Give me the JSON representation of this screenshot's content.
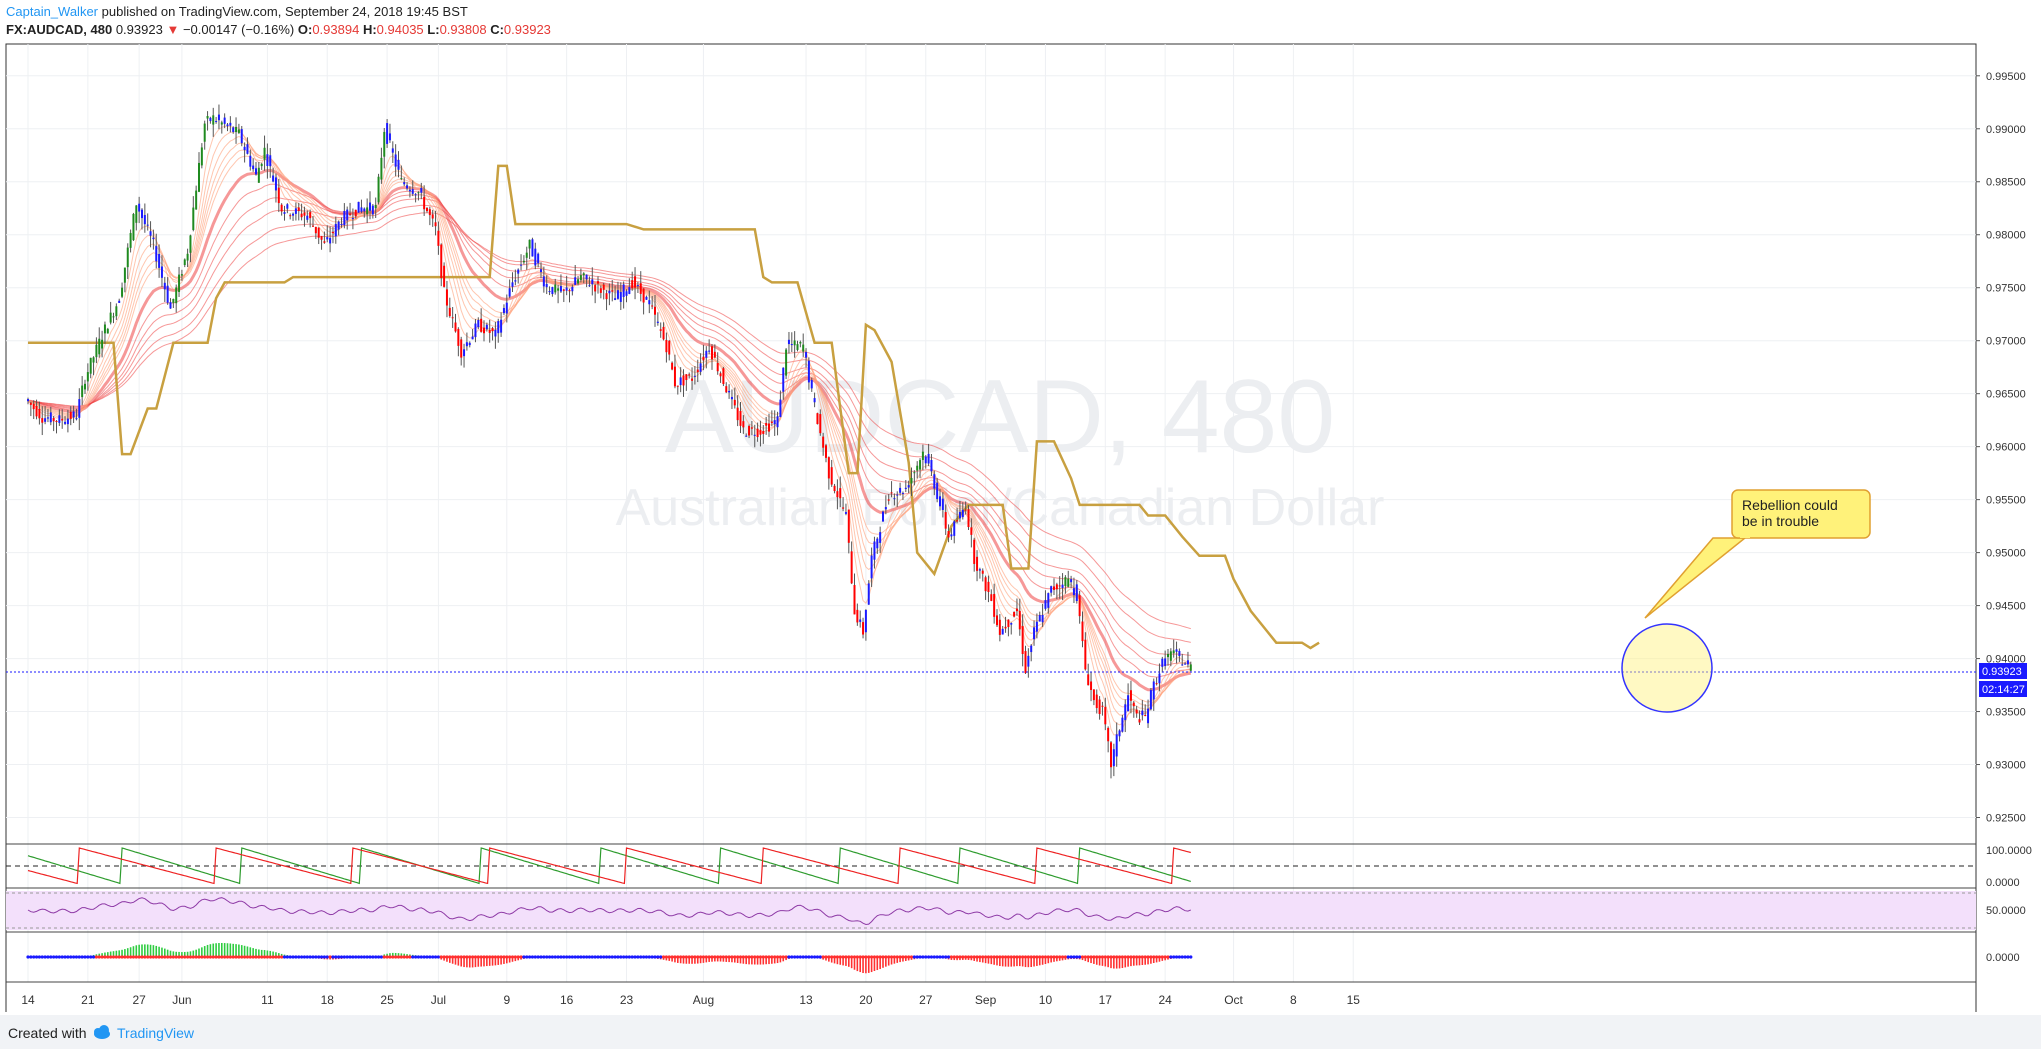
{
  "header": {
    "author": "Captain_Walker",
    "published_text": "published on TradingView.com, September 24, 2018 19:45 BST",
    "symbol": "FX:AUDCAD, 480",
    "last": "0.93923",
    "change": "−0.00147 (−0.16%)",
    "open_label": "O:",
    "open": "0.93894",
    "high_label": "H:",
    "high": "0.94035",
    "low_label": "L:",
    "low": "0.93808",
    "close_label": "C:",
    "close": "0.93923"
  },
  "watermark": {
    "symbol": "AUDCAD, 480",
    "name": "Australian Dollar/Canadian Dollar"
  },
  "annotation": {
    "line1": "Rebellion could",
    "line2": "be in trouble"
  },
  "price_tag": {
    "value": "0.93923",
    "countdown": "02:14:27"
  },
  "footer": {
    "created_with": "Created with",
    "brand": "TradingView"
  },
  "colors": {
    "bull": "#1f8a1f",
    "bear": "#ff0000",
    "neutral": "#1a1aff",
    "ema_short": "#ffa07a",
    "ema_long": "#ee4444",
    "trail": "#c8a040",
    "rsi_band": "#f3e0fb",
    "rsi_line": "#8e3aa6"
  },
  "chart_data": {
    "type": "candlestick",
    "y_axis": {
      "min": 0.9225,
      "max": 0.998,
      "tick_labels": [
        "0.99500",
        "0.99000",
        "0.98500",
        "0.98000",
        "0.97500",
        "0.97000",
        "0.96500",
        "0.96000",
        "0.95500",
        "0.95000",
        "0.94500",
        "0.94000",
        "0.93500",
        "0.93000",
        "0.92500"
      ],
      "tick_values": [
        0.995,
        0.99,
        0.985,
        0.98,
        0.975,
        0.97,
        0.965,
        0.96,
        0.955,
        0.95,
        0.945,
        0.94,
        0.935,
        0.93,
        0.925
      ]
    },
    "x_axis": {
      "labels": [
        "14",
        "21",
        "27",
        "Jun",
        "11",
        "18",
        "25",
        "Jul",
        "9",
        "16",
        "23",
        "Aug",
        "13",
        "20",
        "27",
        "Sep",
        "10",
        "17",
        "24",
        "Oct",
        "8",
        "15"
      ],
      "label_days": [
        0,
        7,
        13,
        18,
        28,
        35,
        42,
        48,
        56,
        63,
        70,
        79,
        91,
        98,
        105,
        112,
        119,
        126,
        133,
        141,
        148,
        155
      ],
      "first_day": "2018-05-14",
      "last_data_day": 133
    },
    "price_path": [
      [
        0,
        0.9645
      ],
      [
        2,
        0.9628
      ],
      [
        4,
        0.9625
      ],
      [
        6,
        0.963
      ],
      [
        7,
        0.9665
      ],
      [
        9,
        0.9705
      ],
      [
        11,
        0.974
      ],
      [
        13,
        0.983
      ],
      [
        15,
        0.979
      ],
      [
        17,
        0.973
      ],
      [
        19,
        0.9785
      ],
      [
        21,
        0.9905
      ],
      [
        22,
        0.991
      ],
      [
        25,
        0.9895
      ],
      [
        27,
        0.9855
      ],
      [
        28,
        0.988
      ],
      [
        30,
        0.9825
      ],
      [
        33,
        0.9818
      ],
      [
        35,
        0.979
      ],
      [
        37,
        0.9815
      ],
      [
        39,
        0.9825
      ],
      [
        41,
        0.9825
      ],
      [
        42,
        0.99
      ],
      [
        44,
        0.985
      ],
      [
        46,
        0.984
      ],
      [
        48,
        0.9805
      ],
      [
        49,
        0.9745
      ],
      [
        51,
        0.969
      ],
      [
        53,
        0.9715
      ],
      [
        55,
        0.9705
      ],
      [
        57,
        0.9755
      ],
      [
        59,
        0.979
      ],
      [
        61,
        0.975
      ],
      [
        63,
        0.9745
      ],
      [
        65,
        0.976
      ],
      [
        67,
        0.975
      ],
      [
        69,
        0.974
      ],
      [
        71,
        0.9755
      ],
      [
        73,
        0.9735
      ],
      [
        75,
        0.9695
      ],
      [
        76,
        0.966
      ],
      [
        78,
        0.9665
      ],
      [
        80,
        0.9695
      ],
      [
        82,
        0.9655
      ],
      [
        84,
        0.9615
      ],
      [
        86,
        0.9615
      ],
      [
        88,
        0.9625
      ],
      [
        89,
        0.9695
      ],
      [
        91,
        0.9695
      ],
      [
        92,
        0.965
      ],
      [
        94,
        0.9575
      ],
      [
        96,
        0.9535
      ],
      [
        97,
        0.9445
      ],
      [
        98,
        0.9425
      ],
      [
        99,
        0.9495
      ],
      [
        101,
        0.9555
      ],
      [
        103,
        0.956
      ],
      [
        105,
        0.9595
      ],
      [
        106,
        0.9575
      ],
      [
        108,
        0.9515
      ],
      [
        110,
        0.9545
      ],
      [
        111,
        0.9495
      ],
      [
        113,
        0.9455
      ],
      [
        114,
        0.9425
      ],
      [
        116,
        0.9445
      ],
      [
        117,
        0.939
      ],
      [
        118,
        0.9425
      ],
      [
        120,
        0.9465
      ],
      [
        122,
        0.9475
      ],
      [
        123,
        0.946
      ],
      [
        124,
        0.939
      ],
      [
        125,
        0.936
      ],
      [
        126,
        0.935
      ],
      [
        127,
        0.93
      ],
      [
        128,
        0.9335
      ],
      [
        129,
        0.9365
      ],
      [
        130,
        0.9345
      ],
      [
        131,
        0.9345
      ],
      [
        132,
        0.9375
      ],
      [
        133,
        0.9395
      ],
      [
        134,
        0.9405
      ],
      [
        135,
        0.94
      ],
      [
        136,
        0.9392
      ]
    ],
    "trail_path": [
      [
        0,
        0.9698
      ],
      [
        10,
        0.9698
      ],
      [
        11,
        0.9593
      ],
      [
        12,
        0.9593
      ],
      [
        14,
        0.9636
      ],
      [
        15,
        0.9636
      ],
      [
        17,
        0.9698
      ],
      [
        18,
        0.9698
      ],
      [
        21,
        0.9698
      ],
      [
        22,
        0.974
      ],
      [
        23,
        0.9755
      ],
      [
        30,
        0.9755
      ],
      [
        31,
        0.976
      ],
      [
        54,
        0.976
      ],
      [
        55,
        0.9865
      ],
      [
        56,
        0.9865
      ],
      [
        57,
        0.981
      ],
      [
        70,
        0.981
      ],
      [
        72,
        0.9805
      ],
      [
        85,
        0.9805
      ],
      [
        86,
        0.976
      ],
      [
        87,
        0.9755
      ],
      [
        90,
        0.9755
      ],
      [
        92,
        0.9698
      ],
      [
        94,
        0.9698
      ],
      [
        96,
        0.9575
      ],
      [
        97,
        0.9575
      ],
      [
        98,
        0.9715
      ],
      [
        99,
        0.971
      ],
      [
        101,
        0.968
      ],
      [
        103,
        0.9585
      ],
      [
        104,
        0.95
      ],
      [
        106,
        0.948
      ],
      [
        108,
        0.9525
      ],
      [
        110,
        0.9545
      ],
      [
        114,
        0.9545
      ],
      [
        115,
        0.9485
      ],
      [
        117,
        0.9485
      ],
      [
        118,
        0.9605
      ],
      [
        120,
        0.9605
      ],
      [
        122,
        0.957
      ],
      [
        123,
        0.9545
      ],
      [
        130,
        0.9545
      ],
      [
        131,
        0.9535
      ],
      [
        133,
        0.9535
      ],
      [
        135,
        0.9515
      ],
      [
        137,
        0.9497
      ],
      [
        140,
        0.9497
      ],
      [
        141,
        0.9475
      ],
      [
        143,
        0.9445
      ],
      [
        145,
        0.9425
      ],
      [
        146,
        0.9415
      ],
      [
        149,
        0.9415
      ],
      [
        150,
        0.941
      ],
      [
        151,
        0.9415
      ]
    ],
    "oscillator_axis": [
      "100.0000",
      "0.0000"
    ],
    "rsi_axis": [
      "50.0000"
    ],
    "histogram_axis": [
      "0.0000"
    ]
  }
}
